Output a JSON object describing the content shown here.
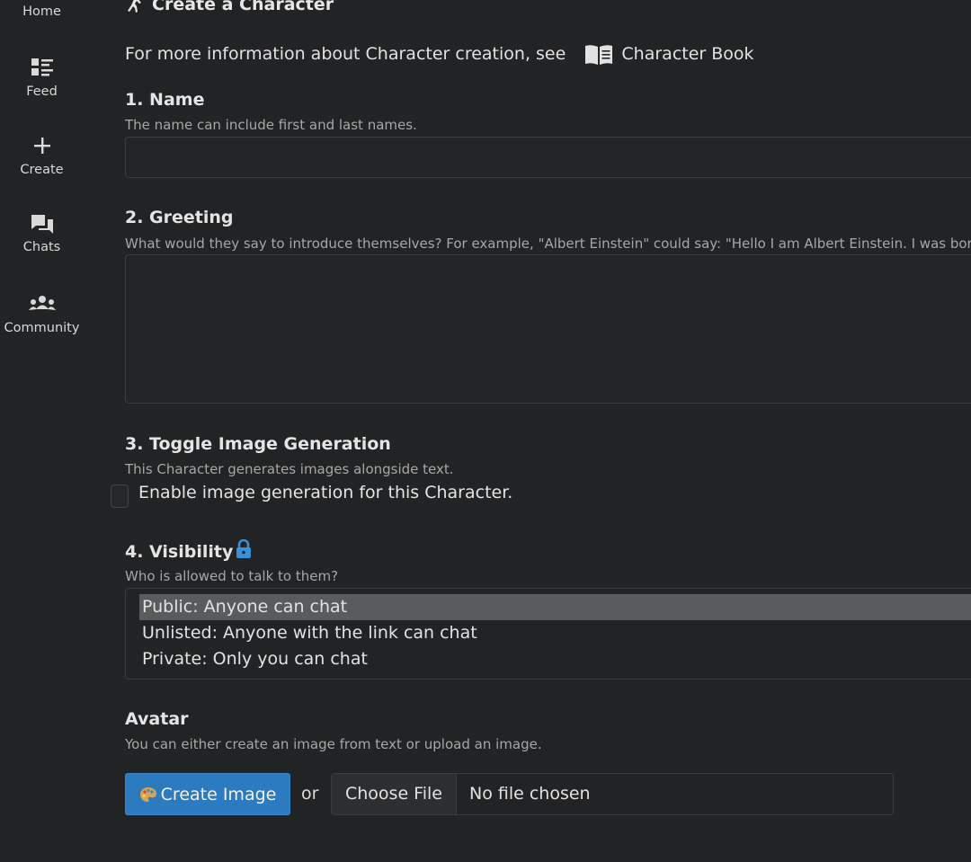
{
  "sidebar": {
    "items": [
      {
        "label": "Home",
        "icon": "home-icon"
      },
      {
        "label": "Feed",
        "icon": "feed-icon"
      },
      {
        "label": "Create",
        "icon": "plus-icon"
      },
      {
        "label": "Chats",
        "icon": "chat-bubbles-icon"
      },
      {
        "label": "Community",
        "icon": "community-icon"
      }
    ]
  },
  "page": {
    "title": "Create a Character",
    "intro": "For more information about Character creation, see",
    "book_link": "Character Book"
  },
  "name_section": {
    "heading": "1. Name",
    "description": "The name can include first and last names.",
    "value": ""
  },
  "greeting_section": {
    "heading": "2. Greeting",
    "description": "What would they say to introduce themselves? For example, \"Albert Einstein\" could say: \"Hello I am Albert Einstein. I was born",
    "value": ""
  },
  "image_gen_section": {
    "heading": "3. Toggle Image Generation",
    "description": "This Character generates images alongside text.",
    "checkbox_label": "Enable image generation for this Character.",
    "checked": false
  },
  "visibility_section": {
    "heading": "4. Visibility",
    "description": "Who is allowed to talk to them?",
    "options": [
      "Public: Anyone can chat",
      "Unlisted: Anyone with the link can chat",
      "Private: Only you can chat"
    ],
    "selected_option": "Public: Anyone can chat"
  },
  "avatar_section": {
    "heading": "Avatar",
    "description": "You can either create an image from text or upload an image.",
    "create_button": "Create Image",
    "or_text": "or",
    "choose_file_button": "Choose File",
    "file_status": "No file chosen"
  },
  "colors": {
    "background": "#222324",
    "accent_button": "#2c7bc1",
    "lock_icon": "#3b8fd6",
    "selected_option": "#5a5b5d"
  }
}
